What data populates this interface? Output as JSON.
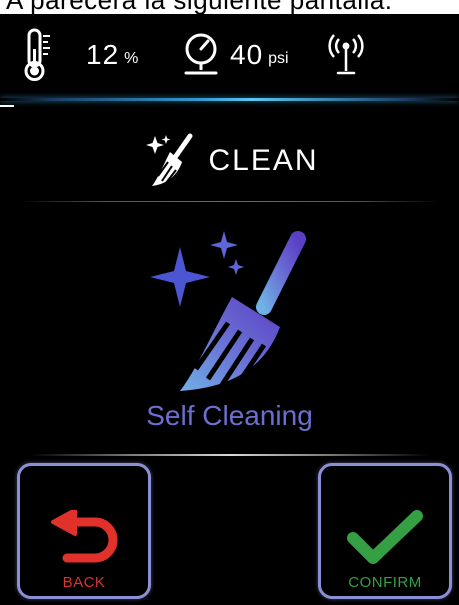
{
  "caption": {
    "text": "A parecerá la siguiente pantalla:"
  },
  "status_bar": {
    "temperature": {
      "icon": "thermometer-icon",
      "value": "12",
      "unit": "%"
    },
    "pressure": {
      "icon": "pressure-gauge-icon",
      "value": "40",
      "unit": "psi"
    },
    "connectivity": {
      "icon": "wireless-antenna-icon"
    }
  },
  "header": {
    "icon": "broom-sparkle-icon",
    "title": "CLEAN"
  },
  "main": {
    "icon": "broom-sparkle-icon",
    "mode_label": "Self Cleaning"
  },
  "buttons": {
    "back": {
      "icon": "undo-arrow-icon",
      "label": "BACK",
      "color": "#e0312b"
    },
    "confirm": {
      "icon": "check-mark-icon",
      "label": "CONFIRM",
      "color": "#35a043"
    }
  },
  "colors": {
    "background": "#000000",
    "accent_purple": "#6b6fd0",
    "button_border": "#8a8fd6",
    "glow_blue": "#34a0d6"
  }
}
